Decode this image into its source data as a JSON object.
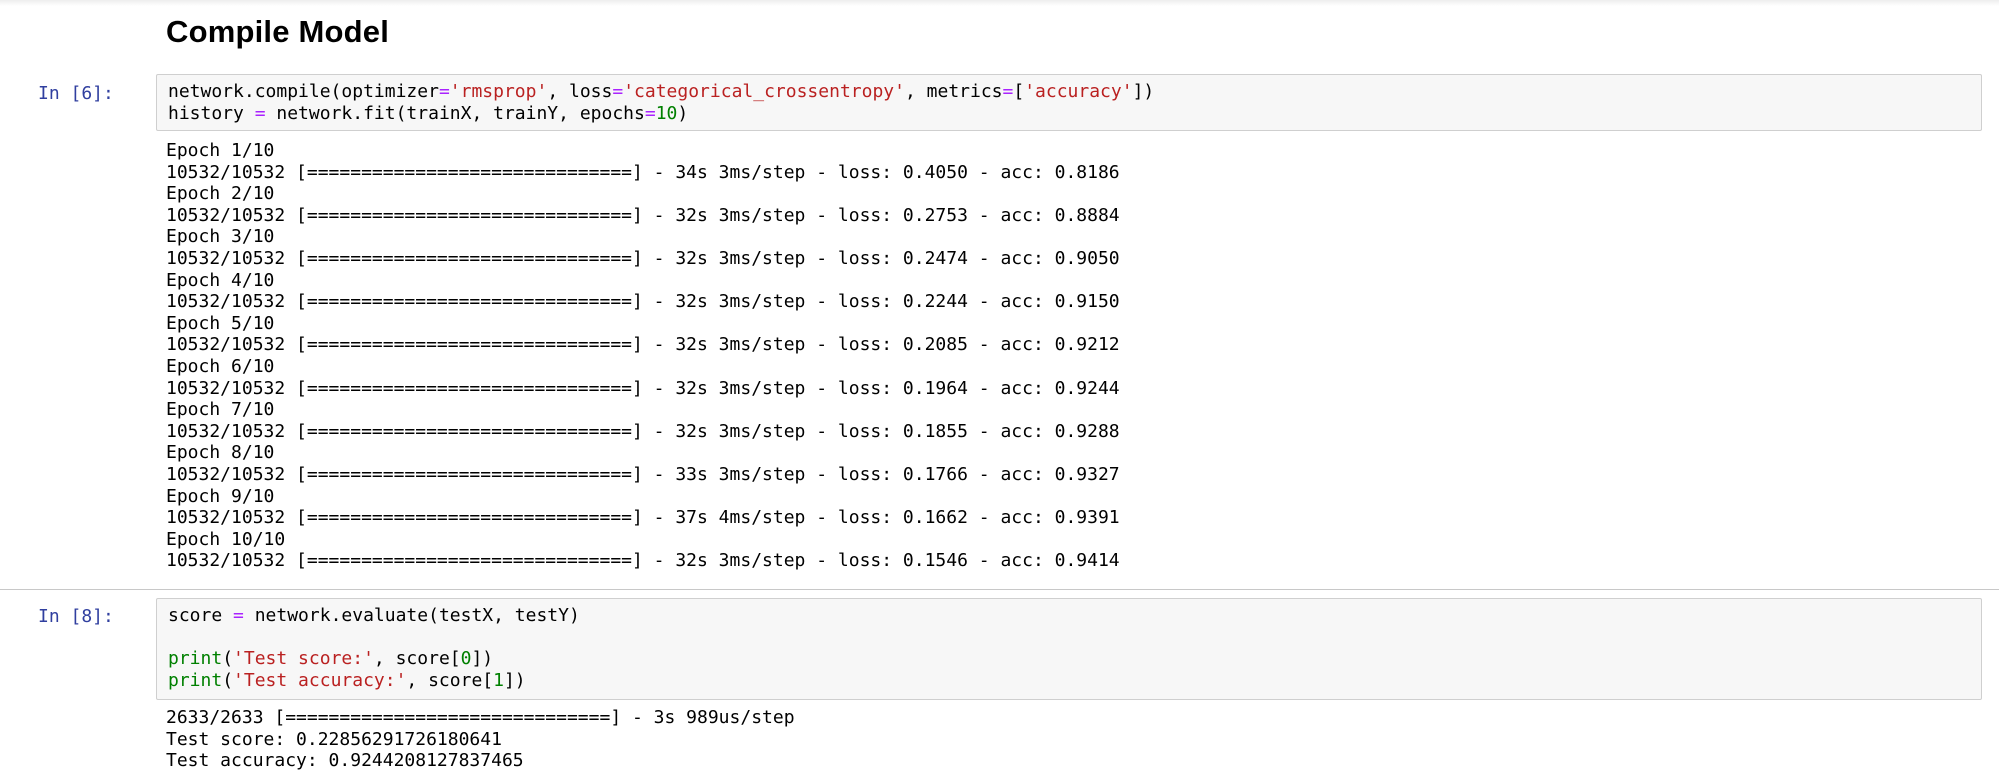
{
  "heading": "Compile Model",
  "cells": [
    {
      "prompt": "In [6]:",
      "code_lines": [
        [
          {
            "t": "network.compile(optimizer",
            "c": ""
          },
          {
            "t": "=",
            "c": "o"
          },
          {
            "t": "'rmsprop'",
            "c": "s"
          },
          {
            "t": ", loss",
            "c": ""
          },
          {
            "t": "=",
            "c": "o"
          },
          {
            "t": "'categorical_crossentropy'",
            "c": "s"
          },
          {
            "t": ", metrics",
            "c": ""
          },
          {
            "t": "=",
            "c": "o"
          },
          {
            "t": "[",
            "c": ""
          },
          {
            "t": "'accuracy'",
            "c": "s"
          },
          {
            "t": "])",
            "c": ""
          }
        ],
        [
          {
            "t": "history ",
            "c": ""
          },
          {
            "t": "=",
            "c": "o"
          },
          {
            "t": " network.fit(trainX, trainY, epochs",
            "c": ""
          },
          {
            "t": "=",
            "c": "o"
          },
          {
            "t": "10",
            "c": "n"
          },
          {
            "t": ")",
            "c": ""
          }
        ]
      ],
      "output_lines": [
        "Epoch 1/10",
        "10532/10532 [==============================] - 34s 3ms/step - loss: 0.4050 - acc: 0.8186",
        "Epoch 2/10",
        "10532/10532 [==============================] - 32s 3ms/step - loss: 0.2753 - acc: 0.8884",
        "Epoch 3/10",
        "10532/10532 [==============================] - 32s 3ms/step - loss: 0.2474 - acc: 0.9050",
        "Epoch 4/10",
        "10532/10532 [==============================] - 32s 3ms/step - loss: 0.2244 - acc: 0.9150",
        "Epoch 5/10",
        "10532/10532 [==============================] - 32s 3ms/step - loss: 0.2085 - acc: 0.9212",
        "Epoch 6/10",
        "10532/10532 [==============================] - 32s 3ms/step - loss: 0.1964 - acc: 0.9244",
        "Epoch 7/10",
        "10532/10532 [==============================] - 32s 3ms/step - loss: 0.1855 - acc: 0.9288",
        "Epoch 8/10",
        "10532/10532 [==============================] - 33s 3ms/step - loss: 0.1766 - acc: 0.9327",
        "Epoch 9/10",
        "10532/10532 [==============================] - 37s 4ms/step - loss: 0.1662 - acc: 0.9391",
        "Epoch 10/10",
        "10532/10532 [==============================] - 32s 3ms/step - loss: 0.1546 - acc: 0.9414"
      ]
    },
    {
      "prompt": "In [8]:",
      "code_lines": [
        [
          {
            "t": "score ",
            "c": ""
          },
          {
            "t": "=",
            "c": "o"
          },
          {
            "t": " network.evaluate(testX, testY)",
            "c": ""
          }
        ],
        [],
        [
          {
            "t": "print",
            "c": "k"
          },
          {
            "t": "(",
            "c": ""
          },
          {
            "t": "'Test score:'",
            "c": "s"
          },
          {
            "t": ", score[",
            "c": ""
          },
          {
            "t": "0",
            "c": "n"
          },
          {
            "t": "])",
            "c": ""
          }
        ],
        [
          {
            "t": "print",
            "c": "k"
          },
          {
            "t": "(",
            "c": ""
          },
          {
            "t": "'Test accuracy:'",
            "c": "s"
          },
          {
            "t": ", score[",
            "c": ""
          },
          {
            "t": "1",
            "c": "n"
          },
          {
            "t": "])",
            "c": ""
          }
        ]
      ],
      "output_lines": [
        "2633/2633 [==============================] - 3s 989us/step",
        "Test score: 0.22856291726180641",
        "Test accuracy: 0.9244208127837465"
      ]
    }
  ]
}
